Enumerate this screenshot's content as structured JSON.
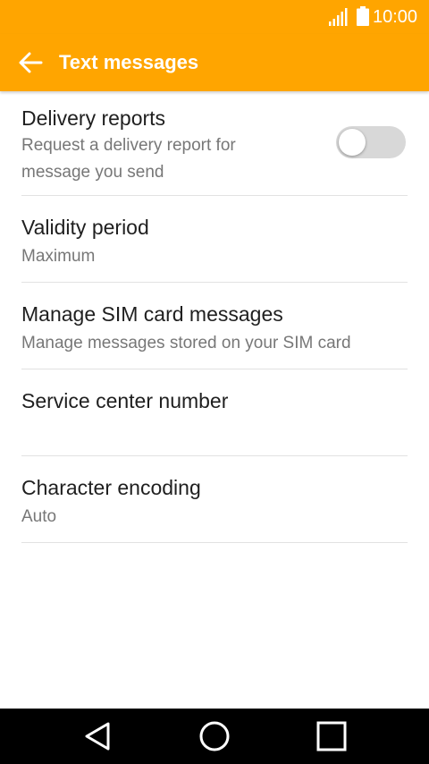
{
  "status_bar": {
    "time": "10:00",
    "signal_icon": "signal-icon",
    "battery_icon": "battery-icon"
  },
  "app_bar": {
    "title": "Text messages",
    "back_icon": "arrow-back-icon"
  },
  "settings": {
    "delivery_reports": {
      "title": "Delivery reports",
      "subtitle_line1": "Request a delivery report for",
      "subtitle_line2": "message you send",
      "toggle_on": false
    },
    "validity_period": {
      "title": "Validity period",
      "subtitle": "Maximum"
    },
    "manage_sim": {
      "title": "Manage SIM card messages",
      "subtitle": "Manage messages stored on your SIM card"
    },
    "service_center": {
      "title": "Service center number",
      "subtitle": ""
    },
    "character_encoding": {
      "title": "Character encoding",
      "subtitle": "Auto"
    }
  },
  "nav_bar": {
    "back": "nav-back-icon",
    "home": "nav-home-icon",
    "recents": "nav-recents-icon"
  },
  "colors": {
    "accent": "#ffa500",
    "toggle_off": "#d8d8d8",
    "divider": "#e2e2e2"
  }
}
